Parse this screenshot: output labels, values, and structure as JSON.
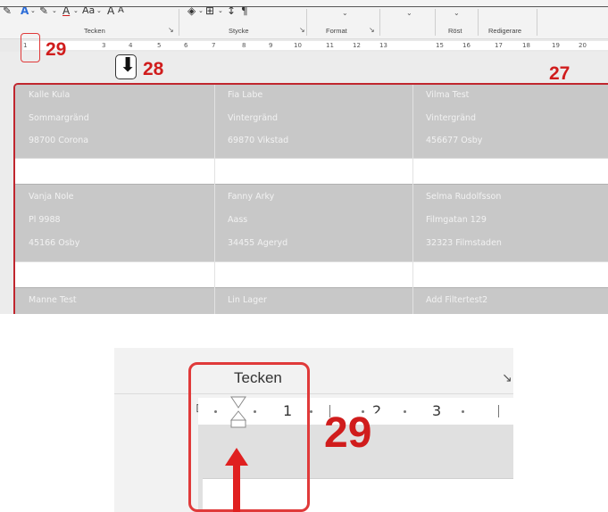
{
  "ribbon": {
    "groups": [
      "Tecken",
      "Stycke",
      "Format",
      "Röst",
      "Redigerare"
    ],
    "icons": [
      "font-color-icon",
      "highlight-icon",
      "text-color-icon",
      "change-case-icon",
      "grow-font-icon",
      "shrink-font-icon",
      "shading-icon",
      "borders-icon",
      "sort-icon",
      "pilcrow-icon"
    ],
    "format_painter_glyph": "✎",
    "font_color_glyph": "A",
    "case_label": "Aa",
    "grow_label": "A",
    "shrink_label": "A",
    "sort_glyph": "↕",
    "pilcrow_glyph": "¶"
  },
  "ruler": {
    "labels": [
      "1",
      "2",
      "3",
      "4",
      "5",
      "6",
      "7",
      "8",
      "9",
      "10",
      "11",
      "12",
      "13",
      "14",
      "15",
      "16",
      "17",
      "18",
      "19",
      "20"
    ]
  },
  "annotations": {
    "label_29": "29",
    "label_28": "28",
    "label_27": "27"
  },
  "table": {
    "rows": [
      {
        "cells": [
          [
            "Kalle Kula",
            "Sommargränd",
            "98700 Corona"
          ],
          [
            "Fia Labe",
            "Vintergränd",
            "69870 Vikstad"
          ],
          [
            "Vilma Test",
            "Vintergränd",
            "456677 Osby"
          ]
        ]
      },
      {
        "cells": [
          [
            "Vanja Nole",
            "Pl 9988",
            "45166 Osby"
          ],
          [
            "Fanny Arky",
            "Aass",
            "34455 Ageryd"
          ],
          [
            "Selma Rudolfsson",
            "Filmgatan 129",
            "32323 Filmstaden"
          ]
        ]
      },
      {
        "cells": [
          [
            "Manne Test",
            "",
            ""
          ],
          [
            "Lin Lager",
            "",
            ""
          ],
          [
            "Add Filtertest2",
            "",
            ""
          ]
        ]
      }
    ]
  },
  "zoom": {
    "group_title": "Tecken",
    "ruler_labels": [
      "1",
      "2",
      "3"
    ],
    "label_29": "29"
  },
  "colors": {
    "annotation_red": "#d01c1c",
    "label_bg": "#c8c8c8",
    "highlight_frame": "#c0262e"
  }
}
